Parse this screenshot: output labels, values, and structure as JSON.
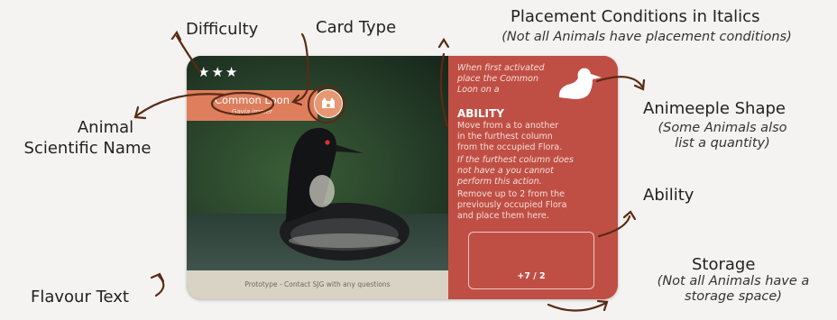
{
  "annotations": {
    "difficulty": "Difficulty",
    "card_type": "Card Type",
    "placement_title": "Placement Conditions in Italics",
    "placement_sub": "(Not all Animals have placement conditions)",
    "animeeple_title": "Animeeple Shape",
    "animeeple_sub_1": "(Some Animals also",
    "animeeple_sub_2": "list a quantity)",
    "ability": "Ability",
    "storage_title": "Storage",
    "storage_sub_1": "(Not all Animals have a",
    "storage_sub_2": "storage space)",
    "animal_line_1": "Animal",
    "animal_line_2": "Scientific Name",
    "flavour": "Flavour Text"
  },
  "card": {
    "stars": "★★★",
    "name": "Common Loon",
    "scientific": "Gavia immer",
    "placement_lines": [
      "When first activated",
      "place the Common",
      "Loon on a"
    ],
    "ability_heading": "ABILITY",
    "ability_lines": [
      "Move from a  to another",
      " in the furthest column",
      "from the occupied Flora.",
      "If the furthest column does",
      "not have a  you cannot",
      "perform this action.",
      "Remove up to 2  from the",
      "previously occupied Flora",
      "and place them here."
    ],
    "storage_value": "+7  / 2",
    "flavour": "Prototype - Contact SJG with any questions"
  },
  "colors": {
    "card_red": "#c95c50",
    "panel_red": "#bf4f45",
    "banner": "#de7e5d",
    "arrow": "#5a2a14"
  }
}
